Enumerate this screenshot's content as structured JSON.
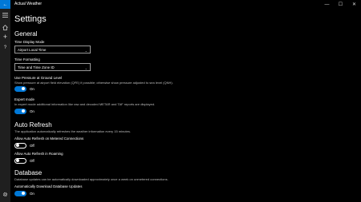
{
  "window": {
    "title": "Actual Weather",
    "back_glyph": "←",
    "minimize_glyph": "—",
    "maximize_glyph": "☐",
    "close_glyph": "✕"
  },
  "nav": {
    "items": [
      {
        "name": "hamburger-menu-icon",
        "icon": "hamburger"
      },
      {
        "name": "home-icon",
        "icon": "home"
      },
      {
        "name": "add-icon",
        "icon": "plus"
      },
      {
        "name": "help-icon",
        "icon": "question"
      },
      {
        "name": "settings-gear-icon",
        "icon": "gear"
      }
    ],
    "help_glyph": "?",
    "add_glyph": "+"
  },
  "page": {
    "title": "Settings"
  },
  "general": {
    "title": "General",
    "time_display_mode": {
      "label": "Time Display Mode",
      "value": "Airport Local Time",
      "chevron": "⌄"
    },
    "time_formatting": {
      "label": "Time Formatting",
      "value": "Time and Time Zone ID",
      "chevron": "⌄"
    },
    "pressure": {
      "label": "Use Pressure at Ground Level",
      "description": "Show pressure at airport field elevation (QFE) if possible; otherwise show pressure adjusted to sea level (QNH).",
      "state": "On"
    },
    "expert_mode": {
      "label": "Expert mode",
      "description": "In expert mode additional information like raw and decoded METAR and TAF reports are displayed.",
      "state": "On"
    }
  },
  "auto_refresh": {
    "title": "Auto Refresh",
    "description": "The application automatically refreshes the weather information every 15 minutes.",
    "metered": {
      "label": "Allow Auto Refresh on Metered Connections",
      "state": "Off"
    },
    "roaming": {
      "label": "Allow Auto Refresh in Roaming",
      "state": "Off"
    }
  },
  "database": {
    "title": "Database",
    "description": "Database updates can be automatically downloaded approximately once a week on unmetered connections.",
    "auto_download": {
      "label": "Automatically Download Database Updates",
      "state": "On"
    }
  },
  "colors": {
    "accent": "#0078d7",
    "background": "#000000",
    "nav_background": "#1f1f1f"
  }
}
